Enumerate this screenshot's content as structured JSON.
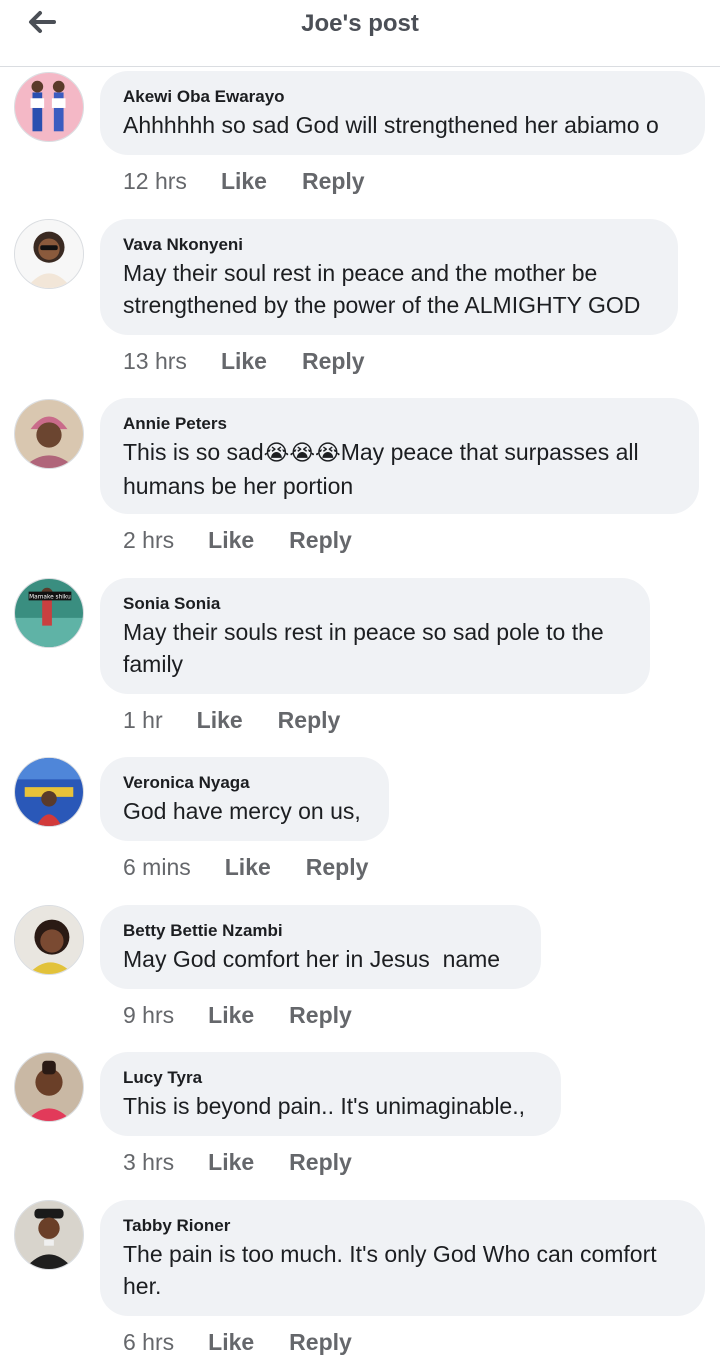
{
  "header": {
    "title": "Joe's post",
    "back_icon": "arrow-left-icon"
  },
  "comments": [
    {
      "author": "Akewi Oba Ewarayo",
      "text": "Ahhhhhh so sad God will strengthened her abiamo o",
      "time": "12 hrs",
      "like": "Like",
      "reply": "Reply"
    },
    {
      "author": "Vava Nkonyeni",
      "text": "May their soul rest in peace and the mother be strengthened by the power of the ALMIGHTY GOD",
      "time": "13 hrs",
      "like": "Like",
      "reply": "Reply"
    },
    {
      "author": "Annie Peters",
      "text_pre": "This is so sad",
      "emoji": "😭😭😭",
      "text_post": "May peace that surpasses all humans be her portion",
      "time": "2 hrs",
      "like": "Like",
      "reply": "Reply"
    },
    {
      "author": "Sonia Sonia",
      "text": "May their souls rest in peace so sad pole to the family",
      "avatar_caption": "Mamake shiku",
      "time": "1 hr",
      "like": "Like",
      "reply": "Reply"
    },
    {
      "author": "Veronica Nyaga",
      "text": "God have mercy on us,",
      "time": "6 mins",
      "like": "Like",
      "reply": "Reply"
    },
    {
      "author": "Betty Bettie Nzambi",
      "text": "May God comfort her in Jesus  name",
      "time": "9 hrs",
      "like": "Like",
      "reply": "Reply"
    },
    {
      "author": "Lucy Tyra",
      "text": "This is beyond pain.. It's unimaginable.,",
      "time": "3 hrs",
      "like": "Like",
      "reply": "Reply"
    },
    {
      "author": "Tabby Rioner",
      "text": "The pain is too much. It's only God Who can comfort her.",
      "time": "6 hrs",
      "like": "Like",
      "reply": "Reply"
    }
  ],
  "colors": {
    "bubble": "#f0f2f5",
    "meta": "#65676b",
    "text": "#1c1e21",
    "header_title": "#4b4f56"
  }
}
